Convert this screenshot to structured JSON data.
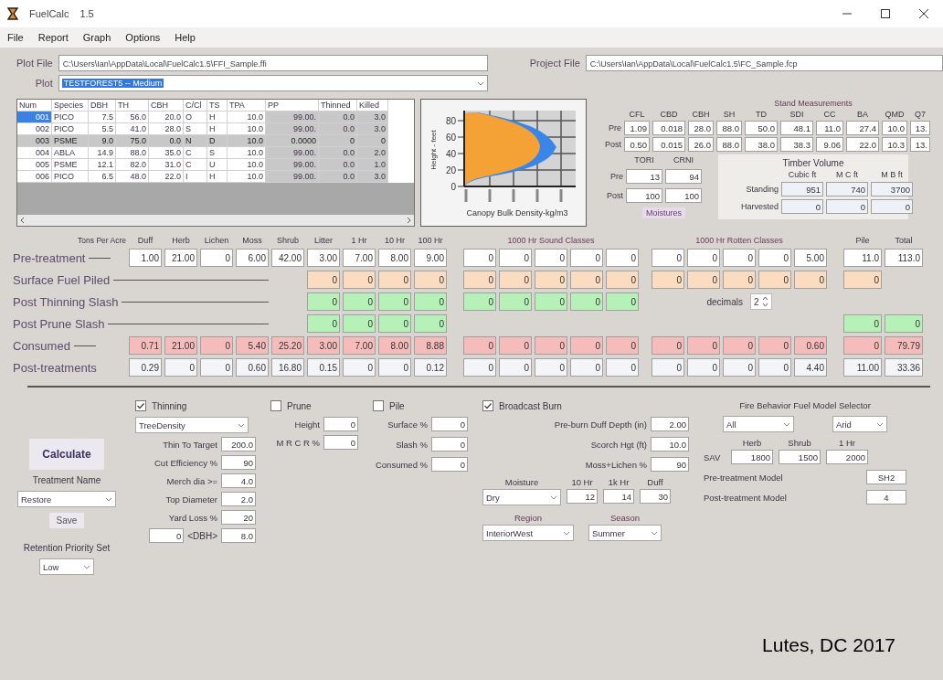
{
  "window": {
    "title": "FuelCalc",
    "version": "1.5"
  },
  "menu": [
    "File",
    "Report",
    "Graph",
    "Options",
    "Help"
  ],
  "plot_file": {
    "label": "Plot File",
    "value": "C:\\Users\\Ian\\AppData\\Local\\FuelCalc1.5\\FFI_Sample.ffi"
  },
  "plot": {
    "label": "Plot",
    "value": "TESTFOREST5 -- Medium"
  },
  "project_file": {
    "label": "Project File",
    "value": "C:\\Users\\Ian\\AppData\\Local\\FuelCalc1.5\\FC_Sample.fcp"
  },
  "tree_table": {
    "columns": [
      {
        "label": "Num",
        "readonly": false
      },
      {
        "label": "Species",
        "readonly": false
      },
      {
        "label": "DBH",
        "readonly": false
      },
      {
        "label": "TH",
        "readonly": false
      },
      {
        "label": "CBH",
        "readonly": false
      },
      {
        "label": "C/Cl",
        "readonly": false
      },
      {
        "label": "TS",
        "readonly": false
      },
      {
        "label": "TPA",
        "readonly": false
      },
      {
        "label": "PP",
        "readonly": true
      },
      {
        "label": "Thinned",
        "readonly": true
      },
      {
        "label": "Killed",
        "readonly": true
      }
    ],
    "rows": [
      {
        "selected": false,
        "focused": true,
        "cells": [
          "001",
          "PICO",
          "7.5",
          "56.0",
          "20.0",
          "O",
          "H",
          "10.0",
          "99.00.",
          "0.0",
          "3.0"
        ]
      },
      {
        "selected": false,
        "focused": false,
        "cells": [
          "002",
          "PICO",
          "5.5",
          "41.0",
          "28.0",
          "S",
          "H",
          "10.0",
          "99.00.",
          "0.0",
          "3.0"
        ]
      },
      {
        "selected": true,
        "focused": false,
        "cells": [
          "003",
          "PSME",
          "9.0",
          "75.0",
          "0.0",
          "N",
          "D",
          "10.0",
          "0.0000",
          "0",
          "0"
        ]
      },
      {
        "selected": false,
        "focused": false,
        "cells": [
          "004",
          "ABLA",
          "14.9",
          "88.0",
          "35.0",
          "C",
          "S",
          "10.0",
          "99.00.",
          "0.0",
          "2.0"
        ]
      },
      {
        "selected": false,
        "focused": false,
        "cells": [
          "005",
          "PSME",
          "12.1",
          "82.0",
          "31.0",
          "C",
          "U",
          "10.0",
          "99.00.",
          "0.0",
          "1.0"
        ]
      },
      {
        "selected": false,
        "focused": false,
        "cells": [
          "006",
          "PICO",
          "6.5",
          "48.0",
          "22.0",
          "I",
          "H",
          "10.0",
          "99.00.",
          "0.0",
          "3.0"
        ]
      }
    ]
  },
  "chart": {
    "ylabel": "Height - feet",
    "xlabel": "Canopy Bulk Density-kg/m3",
    "yticks": [
      "80",
      "60",
      "40",
      "20",
      "0"
    ]
  },
  "stand": {
    "title": "Stand Measurements",
    "columns": [
      "CFL",
      "CBD",
      "CBH",
      "SH",
      "TD",
      "SDI",
      "CC",
      "BA",
      "QMD",
      "Q7"
    ],
    "rows": [
      {
        "label": "Pre",
        "cells": [
          "1.09",
          "0.018",
          "28.0",
          "88.0",
          "50.0",
          "48.1",
          "11.0",
          "27.4",
          "10.0",
          "13."
        ]
      },
      {
        "label": "Post",
        "cells": [
          "0.50",
          "0.015",
          "26.0",
          "88.0",
          "38.0",
          "38.3",
          "9.06",
          "22.0",
          "10.3",
          "13."
        ]
      }
    ]
  },
  "indices": {
    "columns": [
      "TORI",
      "CRNI"
    ],
    "rows": [
      {
        "label": "Pre",
        "cells": [
          "13",
          "94"
        ]
      },
      {
        "label": "Post",
        "cells": [
          "100",
          "100"
        ]
      }
    ],
    "button": "Moistures"
  },
  "timber": {
    "title": "Timber Volume",
    "columns": [
      "Cubic ft",
      "M C ft",
      "M B ft"
    ],
    "rows": [
      {
        "label": "Standing",
        "cells": [
          "951",
          "740",
          "3700"
        ]
      },
      {
        "label": "Harvested",
        "cells": [
          "0",
          "0",
          "0"
        ]
      }
    ]
  },
  "fuels": {
    "row_header": "Tons Per Acre",
    "columns": [
      "Duff",
      "Herb",
      "Lichen",
      "Moss",
      "Shrub",
      "Litter",
      "1 Hr",
      "10 Hr",
      "100 Hr"
    ],
    "groups": [
      "1000 Hr Sound Classes",
      "1000 Hr Rotten Classes"
    ],
    "end_columns": [
      "Pile",
      "Total"
    ],
    "rows": [
      {
        "label": "Pre-treatment",
        "kind": "input",
        "leader": true,
        "cells": [
          "1.00",
          "21.00",
          "0",
          "6.00",
          "42.00",
          "3.00",
          "7.00",
          "8.00",
          "9.00",
          "0",
          "0",
          "0",
          "0",
          "0",
          "0",
          "0",
          "0",
          "0",
          "5.00",
          "11.0",
          "113.0"
        ]
      },
      {
        "label": "Surface Fuel Piled",
        "kind": "piled",
        "leader": true,
        "cells": [
          null,
          null,
          null,
          null,
          null,
          "0",
          "0",
          "0",
          "0",
          "0",
          "0",
          "0",
          "0",
          "0",
          "0",
          "0",
          "0",
          "0",
          "0",
          "0",
          null
        ]
      },
      {
        "label": "Post Thinning Slash",
        "kind": "slash",
        "leader": true,
        "cells": [
          null,
          null,
          null,
          null,
          null,
          "0",
          "0",
          "0",
          "0",
          "0",
          "0",
          "0",
          "0",
          "0",
          null,
          null,
          null,
          null,
          null,
          null,
          null
        ],
        "extra": {
          "label": "decimals",
          "value": "2"
        }
      },
      {
        "label": "Post Prune Slash",
        "kind": "slash",
        "leader": true,
        "cells": [
          null,
          null,
          null,
          null,
          null,
          "0",
          "0",
          "0",
          "0",
          null,
          null,
          null,
          null,
          null,
          null,
          null,
          null,
          null,
          null,
          "0",
          "0"
        ]
      },
      {
        "label": "Consumed",
        "kind": "consumed",
        "leader": true,
        "cells": [
          "0.71",
          "21.00",
          "0",
          "5.40",
          "25.20",
          "3.00",
          "7.00",
          "8.00",
          "8.88",
          "0",
          "0",
          "0",
          "0",
          "0",
          "0",
          "0",
          "0",
          "0",
          "0.60",
          "0",
          "79.79"
        ]
      },
      {
        "label": "Post-treatments",
        "kind": "result",
        "leader": false,
        "cells": [
          "0.29",
          "0",
          "0",
          "0.60",
          "16.80",
          "0.15",
          "0",
          "0",
          "0.12",
          "0",
          "0",
          "0",
          "0",
          "0",
          "0",
          "0",
          "0",
          "0",
          "4.40",
          "11.00",
          "33.36"
        ]
      }
    ]
  },
  "treatment": {
    "calculate": "Calculate",
    "name_label": "Treatment Name",
    "name": "Restore",
    "save": "Save",
    "retention_label": "Retention Priority Set",
    "retention": "Low"
  },
  "thinning": {
    "label": "Thinning",
    "checked": true,
    "method": "TreeDensity",
    "fields": [
      {
        "label": "Thin To Target",
        "value": "200.0"
      },
      {
        "label": "Cut Efficiency %",
        "value": "90"
      },
      {
        "label": "Merch dia >=",
        "value": "4.0"
      },
      {
        "label": "Top Diameter",
        "value": "2.0"
      },
      {
        "label": "Yard Loss %",
        "value": "20"
      }
    ],
    "dbh": {
      "min": "0",
      "label": "<DBH>",
      "max": "8.0"
    }
  },
  "prune": {
    "label": "Prune",
    "checked": false,
    "fields": [
      {
        "label": "Height",
        "value": "0"
      },
      {
        "label": "M R C R %",
        "value": "0"
      }
    ]
  },
  "pile": {
    "label": "Pile",
    "checked": false,
    "fields": [
      {
        "label": "Surface %",
        "value": "0"
      },
      {
        "label": "Slash %",
        "value": "0"
      },
      {
        "label": "Consumed %",
        "value": "0"
      }
    ]
  },
  "burn": {
    "label": "Broadcast Burn",
    "checked": true,
    "fields": [
      {
        "label": "Pre-burn Duff Depth (in)",
        "value": "2.00"
      },
      {
        "label": "Scorch Hgt (ft)",
        "value": "10.0"
      },
      {
        "label": "Moss+Lichen %",
        "value": "90"
      }
    ],
    "moisture": {
      "label": "Moisture",
      "value": "Dry",
      "columns": [
        "10 Hr",
        "1k Hr",
        "Duff"
      ],
      "values": [
        "12",
        "14",
        "30"
      ]
    },
    "region": {
      "label": "Region",
      "value": "InteriorWest"
    },
    "season": {
      "label": "Season",
      "value": "Summer"
    }
  },
  "fire_model": {
    "title": "Fire Behavior Fuel Model Selector",
    "selectors": [
      "All",
      "Arid"
    ],
    "sav": {
      "label": "SAV",
      "columns": [
        "Herb",
        "Shrub",
        "1 Hr"
      ],
      "values": [
        "1800",
        "1500",
        "2000"
      ]
    },
    "models": [
      {
        "label": "Pre-treatment Model",
        "value": "SH2"
      },
      {
        "label": "Post-treatment Model",
        "value": "4"
      }
    ]
  },
  "caption": "Lutes, DC 2017"
}
